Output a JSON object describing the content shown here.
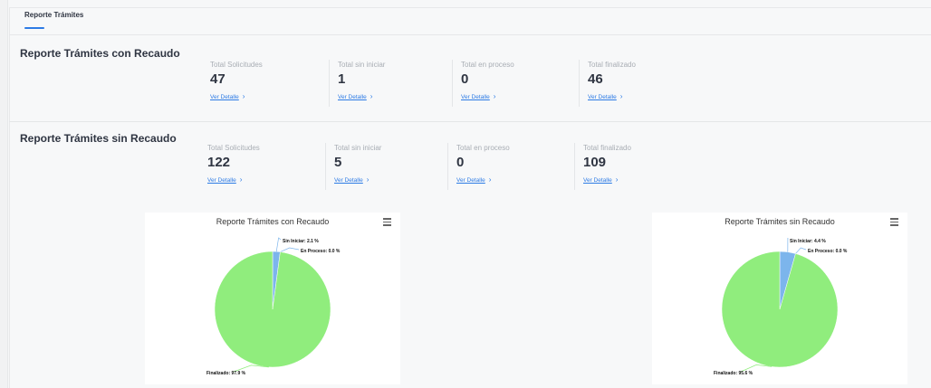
{
  "tab": {
    "label": "Reporte Trámites"
  },
  "sections": [
    {
      "title": "Reporte Trámites con Recaudo",
      "stats": [
        {
          "label": "Total Solicitudes",
          "value": "47",
          "link": "Ver Detalle"
        },
        {
          "label": "Total sin iniciar",
          "value": "1",
          "link": "Ver Detalle"
        },
        {
          "label": "Total en proceso",
          "value": "0",
          "link": "Ver Detalle"
        },
        {
          "label": "Total finalizado",
          "value": "46",
          "link": "Ver Detalle"
        }
      ]
    },
    {
      "title": "Reporte Trámites sin Recaudo",
      "stats": [
        {
          "label": "Total Solicitudes",
          "value": "122",
          "link": "Ver Detalle"
        },
        {
          "label": "Total sin iniciar",
          "value": "5",
          "link": "Ver Detalle"
        },
        {
          "label": "Total en proceso",
          "value": "0",
          "link": "Ver Detalle"
        },
        {
          "label": "Total finalizado",
          "value": "109",
          "link": "Ver Detalle"
        }
      ]
    }
  ],
  "chevron_glyph": "›",
  "colors": {
    "accent": "#2d7be5",
    "finalizado": "#90ed7d",
    "sin_iniciar": "#7cb5ec",
    "en_proceso": "#434348"
  },
  "chart_data": [
    {
      "type": "pie",
      "title": "Reporte Trámites con Recaudo",
      "slices": [
        {
          "label": "Sin Iniciar: 2.1 %",
          "value": 2.1,
          "color": "#7cb5ec"
        },
        {
          "label": "En Proceso: 0.0 %",
          "value": 0.0,
          "color": "#434348"
        },
        {
          "label": "Finalizado: 97.9 %",
          "value": 97.9,
          "color": "#90ed7d"
        }
      ]
    },
    {
      "type": "pie",
      "title": "Reporte Trámites sin Recaudo",
      "slices": [
        {
          "label": "Sin Iniciar: 4.4 %",
          "value": 4.4,
          "color": "#7cb5ec"
        },
        {
          "label": "En Proceso: 0.0 %",
          "value": 0.0,
          "color": "#434348"
        },
        {
          "label": "Finalizado: 95.6 %",
          "value": 95.6,
          "color": "#90ed7d"
        }
      ]
    }
  ]
}
